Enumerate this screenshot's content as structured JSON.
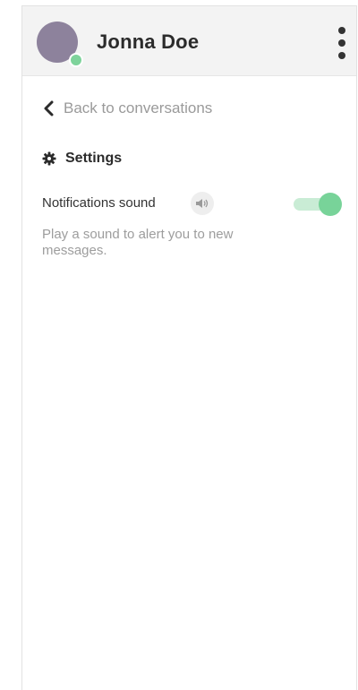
{
  "header": {
    "user_name": "Jonna Doe",
    "avatar_color": "#8d829c",
    "presence_color": "#7ed39b",
    "menu_icon": "vertical-ellipsis-icon"
  },
  "nav": {
    "back_label": "Back to conversations",
    "back_icon": "chevron-left-icon"
  },
  "settings": {
    "heading": "Settings",
    "heading_icon": "gear-icon",
    "notifications": {
      "label": "Notifications sound",
      "icon": "speaker-icon",
      "enabled": true,
      "description": "Play a sound to alert you to new messages.",
      "toggle_color": "#78d399"
    }
  }
}
